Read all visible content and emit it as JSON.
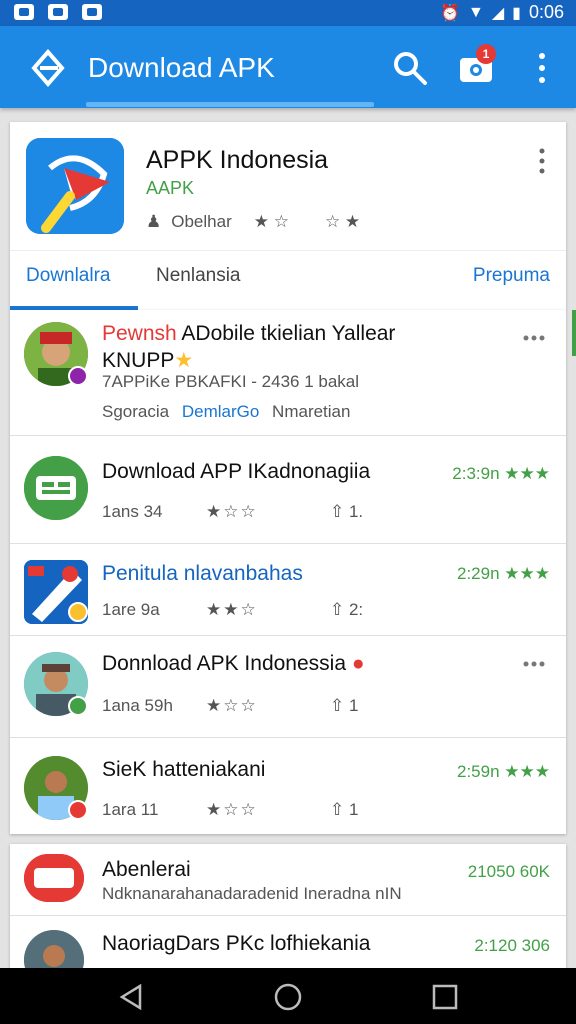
{
  "status_bar": {
    "time": "0:06"
  },
  "app_bar": {
    "title": "Download APK",
    "notification_count": "1"
  },
  "featured": {
    "name": "APPK Indonesia",
    "developer": "AAPK",
    "meta_a": "Obelhar",
    "meta_b": "★ ☆",
    "meta_c": "☆ ★",
    "tabs": [
      {
        "label": "Downlalra",
        "active": true
      },
      {
        "label": "Nenlansia",
        "active": false
      },
      {
        "label": "Prepuma",
        "active": false
      }
    ]
  },
  "list": [
    {
      "title_a": "Pewnsh",
      "title_b": "ADobile tkielian Yallear",
      "title_c": "KNUPP",
      "desc": "7APPiKe PBKAFKI - 2436 1 bakal",
      "links": [
        "Sgoracia",
        "DemlarGo",
        "Nmaretian"
      ]
    },
    {
      "title": "Download APP IKadnonagiia",
      "count": "1ans 34",
      "stars": "★☆☆",
      "downloads": "1.",
      "size": "2:3:9n ★★★"
    },
    {
      "title": "Penitula nlavanbahas",
      "count": "1are 9a",
      "stars": "★★☆",
      "downloads": "2:",
      "size": "2:29n ★★★"
    },
    {
      "title": "Donnload APK Indonessia",
      "count": "1ana 59h",
      "stars": "★☆☆",
      "downloads": "1",
      "size": ""
    },
    {
      "title": "SieK hatteniakani",
      "count": "1ara 11",
      "stars": "★☆☆",
      "downloads": "1",
      "size": "2:59n ★★★"
    }
  ],
  "more_list": [
    {
      "title": "Abenlerai",
      "subtitle": "Ndknanarahanadaradenid Ineradna nIN",
      "size": "21050 60K"
    },
    {
      "title": "NaoriagDars PKc lofhiekania",
      "subtitle": "",
      "size": "2:120 306"
    }
  ],
  "colors": {
    "primary": "#1e88e5",
    "status_bar": "#1565c0",
    "accent": "#43a047",
    "badge": "#e53935"
  }
}
